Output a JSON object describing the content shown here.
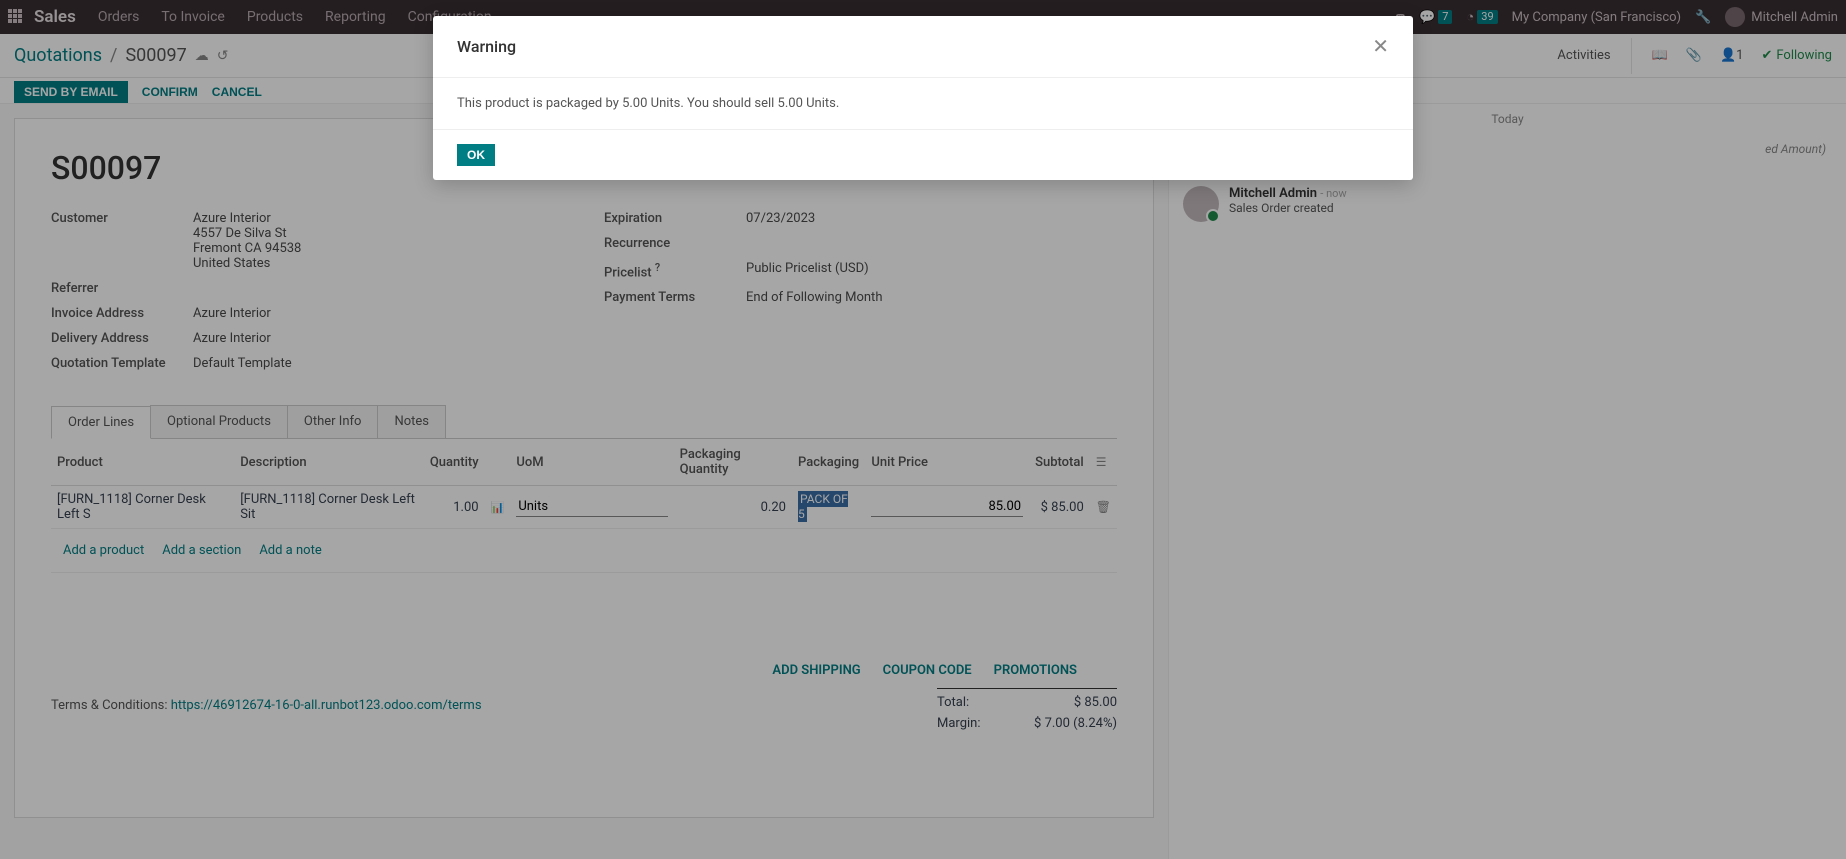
{
  "nav": {
    "brand": "Sales",
    "menus": [
      "Orders",
      "To Invoice",
      "Products",
      "Reporting",
      "Configuration"
    ],
    "chat_badge": "7",
    "clock_badge": "39",
    "company": "My Company (San Francisco)",
    "user": "Mitchell Admin"
  },
  "breadcrumb": {
    "root": "Quotations",
    "current": "S00097"
  },
  "subhead_right": {
    "activities": "Activities",
    "followers": "1",
    "following": "Following"
  },
  "actions": {
    "send": "SEND BY EMAIL",
    "confirm": "CONFIRM",
    "cancel": "CANCEL"
  },
  "so": {
    "name": "S00097",
    "fields_left": {
      "customer_label": "Customer",
      "customer_name": "Azure Interior",
      "addr1": "4557 De Silva St",
      "addr2": "Fremont CA 94538",
      "addr3": "United States",
      "referrer_label": "Referrer",
      "referrer_val": "",
      "invoice_label": "Invoice Address",
      "invoice_val": "Azure Interior",
      "delivery_label": "Delivery Address",
      "delivery_val": "Azure Interior",
      "template_label": "Quotation Template",
      "template_val": "Default Template"
    },
    "fields_right": {
      "expiration_label": "Expiration",
      "expiration_val": "07/23/2023",
      "recurrence_label": "Recurrence",
      "recurrence_val": "",
      "pricelist_label": "Pricelist",
      "pricelist_sup": "?",
      "pricelist_val": "Public Pricelist (USD)",
      "terms_label": "Payment Terms",
      "terms_val": "End of Following Month"
    }
  },
  "tabs": [
    "Order Lines",
    "Optional Products",
    "Other Info",
    "Notes"
  ],
  "table": {
    "headers": {
      "product": "Product",
      "description": "Description",
      "qty": "Quantity",
      "uom": "UoM",
      "pkg_qty": "Packaging Quantity",
      "pkg": "Packaging",
      "unit_price": "Unit Price",
      "subtotal": "Subtotal"
    },
    "row": {
      "product": "[FURN_1118] Corner Desk Left S",
      "description": "[FURN_1118] Corner Desk Left Sit",
      "qty": "1.00",
      "uom": "Units",
      "pkg_qty": "0.20",
      "pkg": "PACK OF 5",
      "unit_price": "85.00",
      "subtotal": "$ 85.00"
    },
    "add_product": "Add a product",
    "add_section": "Add a section",
    "add_note": "Add a note"
  },
  "footer_links": {
    "ship": "ADD SHIPPING",
    "coupon": "COUPON CODE",
    "promo": "PROMOTIONS"
  },
  "totals": {
    "total_label": "Total:",
    "total_val": "$ 85.00",
    "margin_label": "Margin:",
    "margin_val": "$ 7.00 (8.24%)"
  },
  "terms": {
    "prefix": "Terms & Conditions: ",
    "link": "https://46912674-16-0-all.runbot123.odoo.com/terms"
  },
  "chatter": {
    "today": "Today",
    "snippet": "ed Amount)",
    "log_name": "Mitchell Admin",
    "log_time": "- now",
    "log_text": "Sales Order created"
  },
  "modal": {
    "title": "Warning",
    "body": "This product is packaged by 5.00 Units. You should sell 5.00 Units.",
    "ok": "OK"
  }
}
